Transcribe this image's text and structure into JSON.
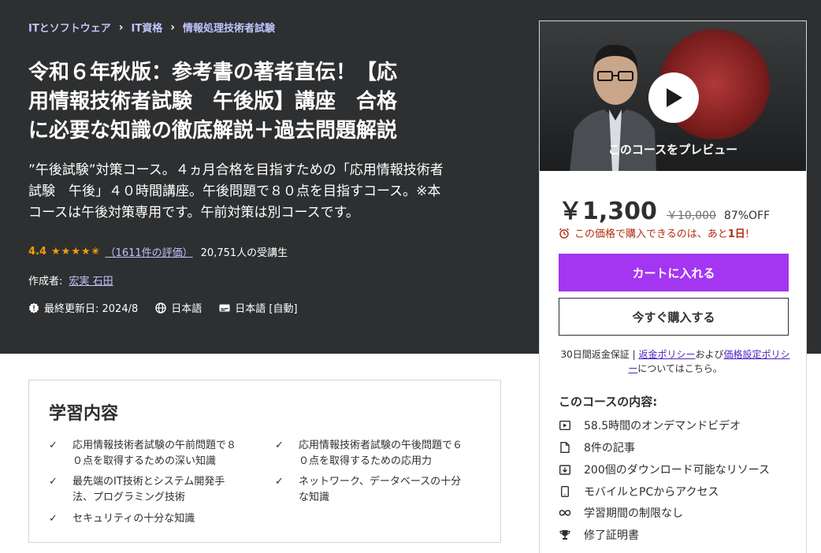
{
  "breadcrumb": [
    "ITとソフトウェア",
    "IT資格",
    "情報処理技術者試験"
  ],
  "course": {
    "title_lines": [
      "令和６年秋版：参考書の著者直伝！【応",
      "用情報技術者試験　午後版】講座　合格",
      "に必要な知識の徹底解説＋過去問題解説"
    ],
    "subtitle_lines": [
      "”午後試験”対策コース。４ヵ月合格を目指すための「応用情報技術者",
      "試験　午後」４０時間講座。午後問題で８０点を目指すコース。※本",
      "コースは午後対策専用です。午前対策は別コースです。"
    ],
    "rating": "4.4",
    "stars": "★★★★✬",
    "rating_count": "（1611件の評価）",
    "students": "20,751人の受講生",
    "author_label": "作成者:",
    "author": "宏実 石田",
    "updated": "最終更新日: 2024/8",
    "language": "日本語",
    "captions": "日本語 [自動]"
  },
  "learn": {
    "title": "学習内容",
    "items": [
      [
        "応用情報技術者試験の午前問題で８",
        "０点を取得するための深い知識"
      ],
      [
        "応用情報技術者試験の午後問題で６",
        "０点を取得するための応用力"
      ],
      [
        "最先端のIT技術とシステム開発手",
        "法、プログラミング技術"
      ],
      [
        "ネットワーク、データベースの十分",
        "な知識"
      ],
      [
        "セキュリティの十分な知識"
      ]
    ]
  },
  "sidebar": {
    "preview_label": "このコースをプレビュー",
    "price": "￥1,300",
    "original_price": "￥10,000",
    "discount": "87%OFF",
    "timer_prefix": "この価格で購入できるのは、あと",
    "timer_bold": "1日",
    "timer_suffix": "!",
    "cart_button": "カートに入れる",
    "buy_button": "今すぐ購入する",
    "guarantee_prefix": "30日間返金保証 | ",
    "refund_policy": "返金ポリシー",
    "guarantee_mid": "および",
    "pricing_policy": "価格設定ポリシ",
    "pricing_policy_2": "ー",
    "guarantee_suffix": "についてはこちら。",
    "includes_title": "このコースの内容:",
    "includes": [
      {
        "icon": "video-icon",
        "text": "58.5時間のオンデマンドビデオ"
      },
      {
        "icon": "file-icon",
        "text": "8件の記事"
      },
      {
        "icon": "download-icon",
        "text": "200個のダウンロード可能なリソース"
      },
      {
        "icon": "mobile-icon",
        "text": "モバイルとPCからアクセス"
      },
      {
        "icon": "infinity-icon",
        "text": "学習期間の制限なし"
      },
      {
        "icon": "trophy-icon",
        "text": "修了証明書"
      }
    ]
  },
  "colors": {
    "hero_bg": "#2d2f31",
    "accent": "#a435f0",
    "link_light": "#c0c4fc",
    "star": "#f69c08",
    "alert": "#b32d0f"
  }
}
